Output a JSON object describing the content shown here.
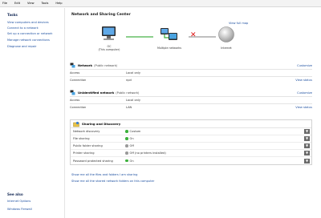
{
  "menubar": {
    "items": [
      "File",
      "Edit",
      "View",
      "Tools",
      "Help"
    ]
  },
  "sidebar": {
    "tasks_title": "Tasks",
    "tasks": [
      "View computers and devices",
      "Connect to a network",
      "Set up a connection or network",
      "Manage network connections",
      "Diagnose and repair"
    ],
    "see_also_title": "See also",
    "see_also": [
      "Internet Options",
      "Windows Firewall"
    ]
  },
  "main": {
    "title": "Network and Sharing Center",
    "view_full_map": "View full map",
    "map": {
      "pc_label": "OC",
      "pc_sublabel": "(This computer)",
      "networks_label": "Multiple networks",
      "internet_label": "Internet"
    }
  },
  "networks": [
    {
      "name": "Network",
      "type": "(Public network)",
      "customize": "Customize",
      "rows": [
        {
          "key": "Access",
          "value": "Local only",
          "link": ""
        },
        {
          "key": "Connection",
          "value": "npd",
          "link": "View status"
        }
      ]
    },
    {
      "name": "Unidentified network",
      "type": "(Public network)",
      "customize": "Customize",
      "rows": [
        {
          "key": "Access",
          "value": "Local only",
          "link": ""
        },
        {
          "key": "Connection",
          "value": "LAN",
          "link": "View status"
        }
      ]
    }
  ],
  "sharing": {
    "title": "Sharing and Discovery",
    "items": [
      {
        "label": "Network discovery",
        "status": "Custom",
        "state": "on"
      },
      {
        "label": "File sharing",
        "status": "On",
        "state": "on"
      },
      {
        "label": "Public folder sharing",
        "status": "Off",
        "state": "off"
      },
      {
        "label": "Printer sharing",
        "status": "Off (no printers installed)",
        "state": "off"
      },
      {
        "label": "Password protected sharing",
        "status": "On",
        "state": "on"
      }
    ]
  },
  "bottom_links": [
    "Show me all the files and folders I am sharing",
    "Show me all the shared network folders on this computer"
  ],
  "colors": {
    "link": "#1c4fa0",
    "on": "#3bb03b",
    "off": "#9a9a9a",
    "line": "#8ccf8c",
    "x": "#dd1111"
  }
}
